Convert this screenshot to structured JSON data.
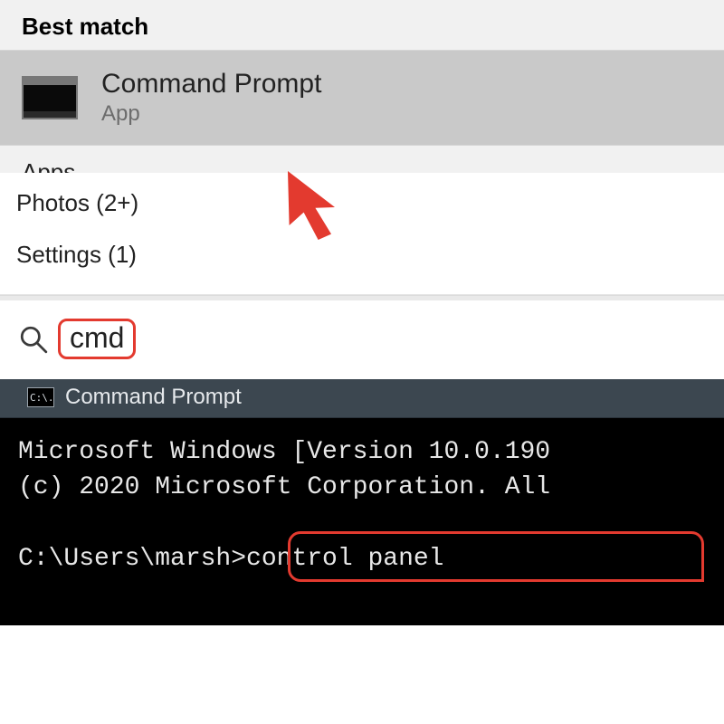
{
  "start": {
    "best_match_heading": "Best match",
    "result": {
      "title": "Command Prompt",
      "subtitle": "App"
    },
    "apps_heading_cut": "Apps"
  },
  "categories": {
    "photos": "Photos (2+)",
    "settings": "Settings (1)"
  },
  "search": {
    "icon": "search-icon",
    "term": "cmd"
  },
  "cmd": {
    "window_title": "Command Prompt",
    "line1": "Microsoft Windows [Version 10.0.190",
    "line2": "(c) 2020 Microsoft Corporation. All",
    "prompt_path": "C:\\Users\\marsh>",
    "prompt_command": "control panel"
  },
  "colors": {
    "annotation_red": "#e33a2f"
  }
}
